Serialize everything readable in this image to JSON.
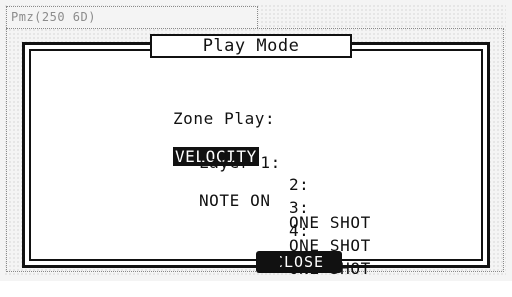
{
  "background": {
    "tab_text": "Pmz(250 6D)"
  },
  "dialog": {
    "title": "Play Mode",
    "zone_play_label": "Zone Play:",
    "zone_play_value": "VELOCITY",
    "layers": [
      {
        "label": "Layer 1:",
        "value": "NOTE ON"
      },
      {
        "label": "2:",
        "value": "ONE SHOT"
      },
      {
        "label": "3:",
        "value": "ONE SHOT"
      },
      {
        "label": "4:",
        "value": "ONE SHOT"
      }
    ],
    "close_label": "CLOSE"
  },
  "colors": {
    "foreground": "#111111",
    "background": "#ffffff",
    "highlight_text": "#ffffff"
  }
}
